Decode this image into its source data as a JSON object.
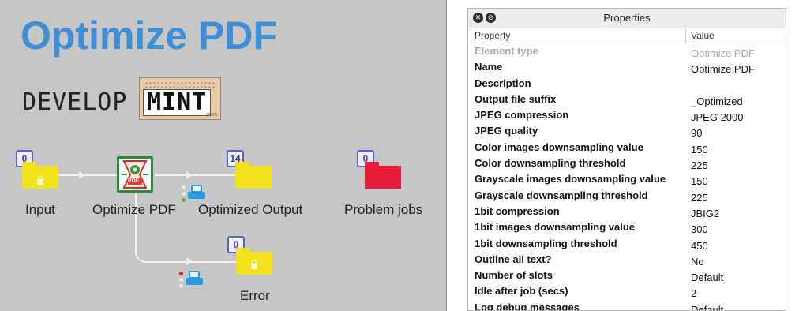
{
  "canvas": {
    "title": "Optimize PDF",
    "logo": {
      "develop": "DEVELOP",
      "mint": "MINT",
      "mint_sub": "TPMS"
    },
    "nodes": {
      "input": {
        "label": "Input",
        "count": "0"
      },
      "optimize": {
        "label": "Optimize PDF",
        "icon_text": "PDF"
      },
      "optimized_output": {
        "label": "Optimized Output",
        "count": "14"
      },
      "problem_jobs": {
        "label": "Problem jobs",
        "count": "0"
      },
      "error": {
        "label": "Error",
        "count": "0"
      }
    },
    "colors": {
      "background": "#c6c6c6",
      "title": "#3f8fd6",
      "folder_yellow": "#f2e21b",
      "folder_red": "#eb1b3a",
      "badge_border": "#5f60c7",
      "printer_blue": "#2a9be3",
      "status_green": "#54b33a",
      "status_red": "#e0201e"
    }
  },
  "properties_panel": {
    "title": "Properties",
    "window_buttons": [
      "close-icon",
      "restore-icon"
    ],
    "columns": {
      "property": "Property",
      "value": "Value"
    },
    "rows": [
      {
        "k": "Element type",
        "v": "Optimize PDF",
        "dim": true
      },
      {
        "k": "Name",
        "v": "Optimize PDF"
      },
      {
        "k": "Description",
        "v": ""
      },
      {
        "k": "Output file suffix",
        "v": "_Optimized"
      },
      {
        "k": "JPEG compression",
        "v": "JPEG 2000"
      },
      {
        "k": "JPEG quality",
        "v": "90"
      },
      {
        "k": "Color images downsampling value",
        "v": "150"
      },
      {
        "k": "Color downsampling threshold",
        "v": "225"
      },
      {
        "k": "Grayscale images downsampling value",
        "v": "150"
      },
      {
        "k": "Grayscale downsampling threshold",
        "v": "225"
      },
      {
        "k": "1bit compression",
        "v": "JBIG2"
      },
      {
        "k": "1bit images downsampling value",
        "v": "300"
      },
      {
        "k": "1bit downsampling threshold",
        "v": "450"
      },
      {
        "k": "Outline all text?",
        "v": "No"
      },
      {
        "k": "Number of slots",
        "v": "Default"
      },
      {
        "k": "Idle after job (secs)",
        "v": "2"
      },
      {
        "k": "Log debug messages",
        "v": "Default"
      }
    ]
  }
}
